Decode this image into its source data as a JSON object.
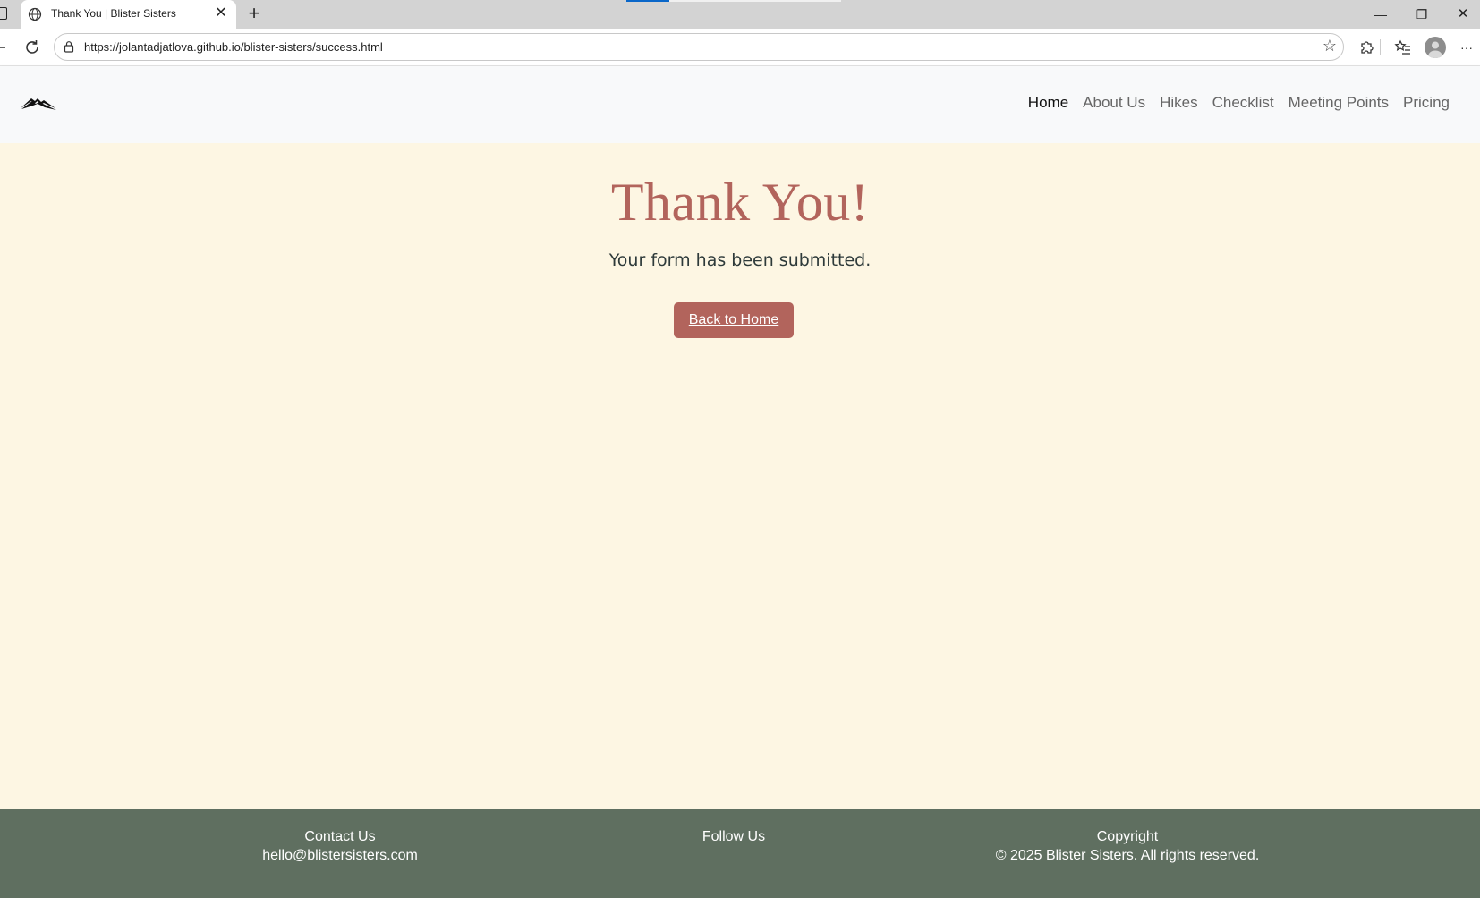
{
  "browser": {
    "tab_title": "Thank You | Blister Sisters",
    "url": "https://jolantadjatlova.github.io/blister-sisters/success.html",
    "tab_close": "✕",
    "new_tab": "+",
    "win_min": "—",
    "win_restore": "❐",
    "win_close": "✕",
    "icons": [
      "globe-icon",
      "close-icon",
      "plus-icon",
      "back-icon",
      "refresh-icon",
      "lock-icon",
      "star-icon",
      "extensions-icon",
      "favorites-icon",
      "profile-icon",
      "more-icon"
    ]
  },
  "header": {
    "logo_name": "mountain-logo",
    "nav": [
      {
        "label": "Home",
        "active": true
      },
      {
        "label": "About Us"
      },
      {
        "label": "Hikes"
      },
      {
        "label": "Checklist"
      },
      {
        "label": "Meeting Points"
      },
      {
        "label": "Pricing"
      }
    ]
  },
  "main": {
    "title": "Thank You!",
    "message": "Your form has been submitted.",
    "button_label": "Back to Home"
  },
  "footer": {
    "contact_title": "Contact Us",
    "contact_email": "hello@blistersisters.com",
    "follow_title": "Follow Us",
    "copyright_title": "Copyright",
    "copyright_text": "© 2025 Blister Sisters. All rights reserved."
  },
  "colors": {
    "accent": "#b2645c",
    "page_bg": "#fdf6e3",
    "footer_bg": "#5f6f60",
    "header_bg": "#f8f9fa"
  }
}
